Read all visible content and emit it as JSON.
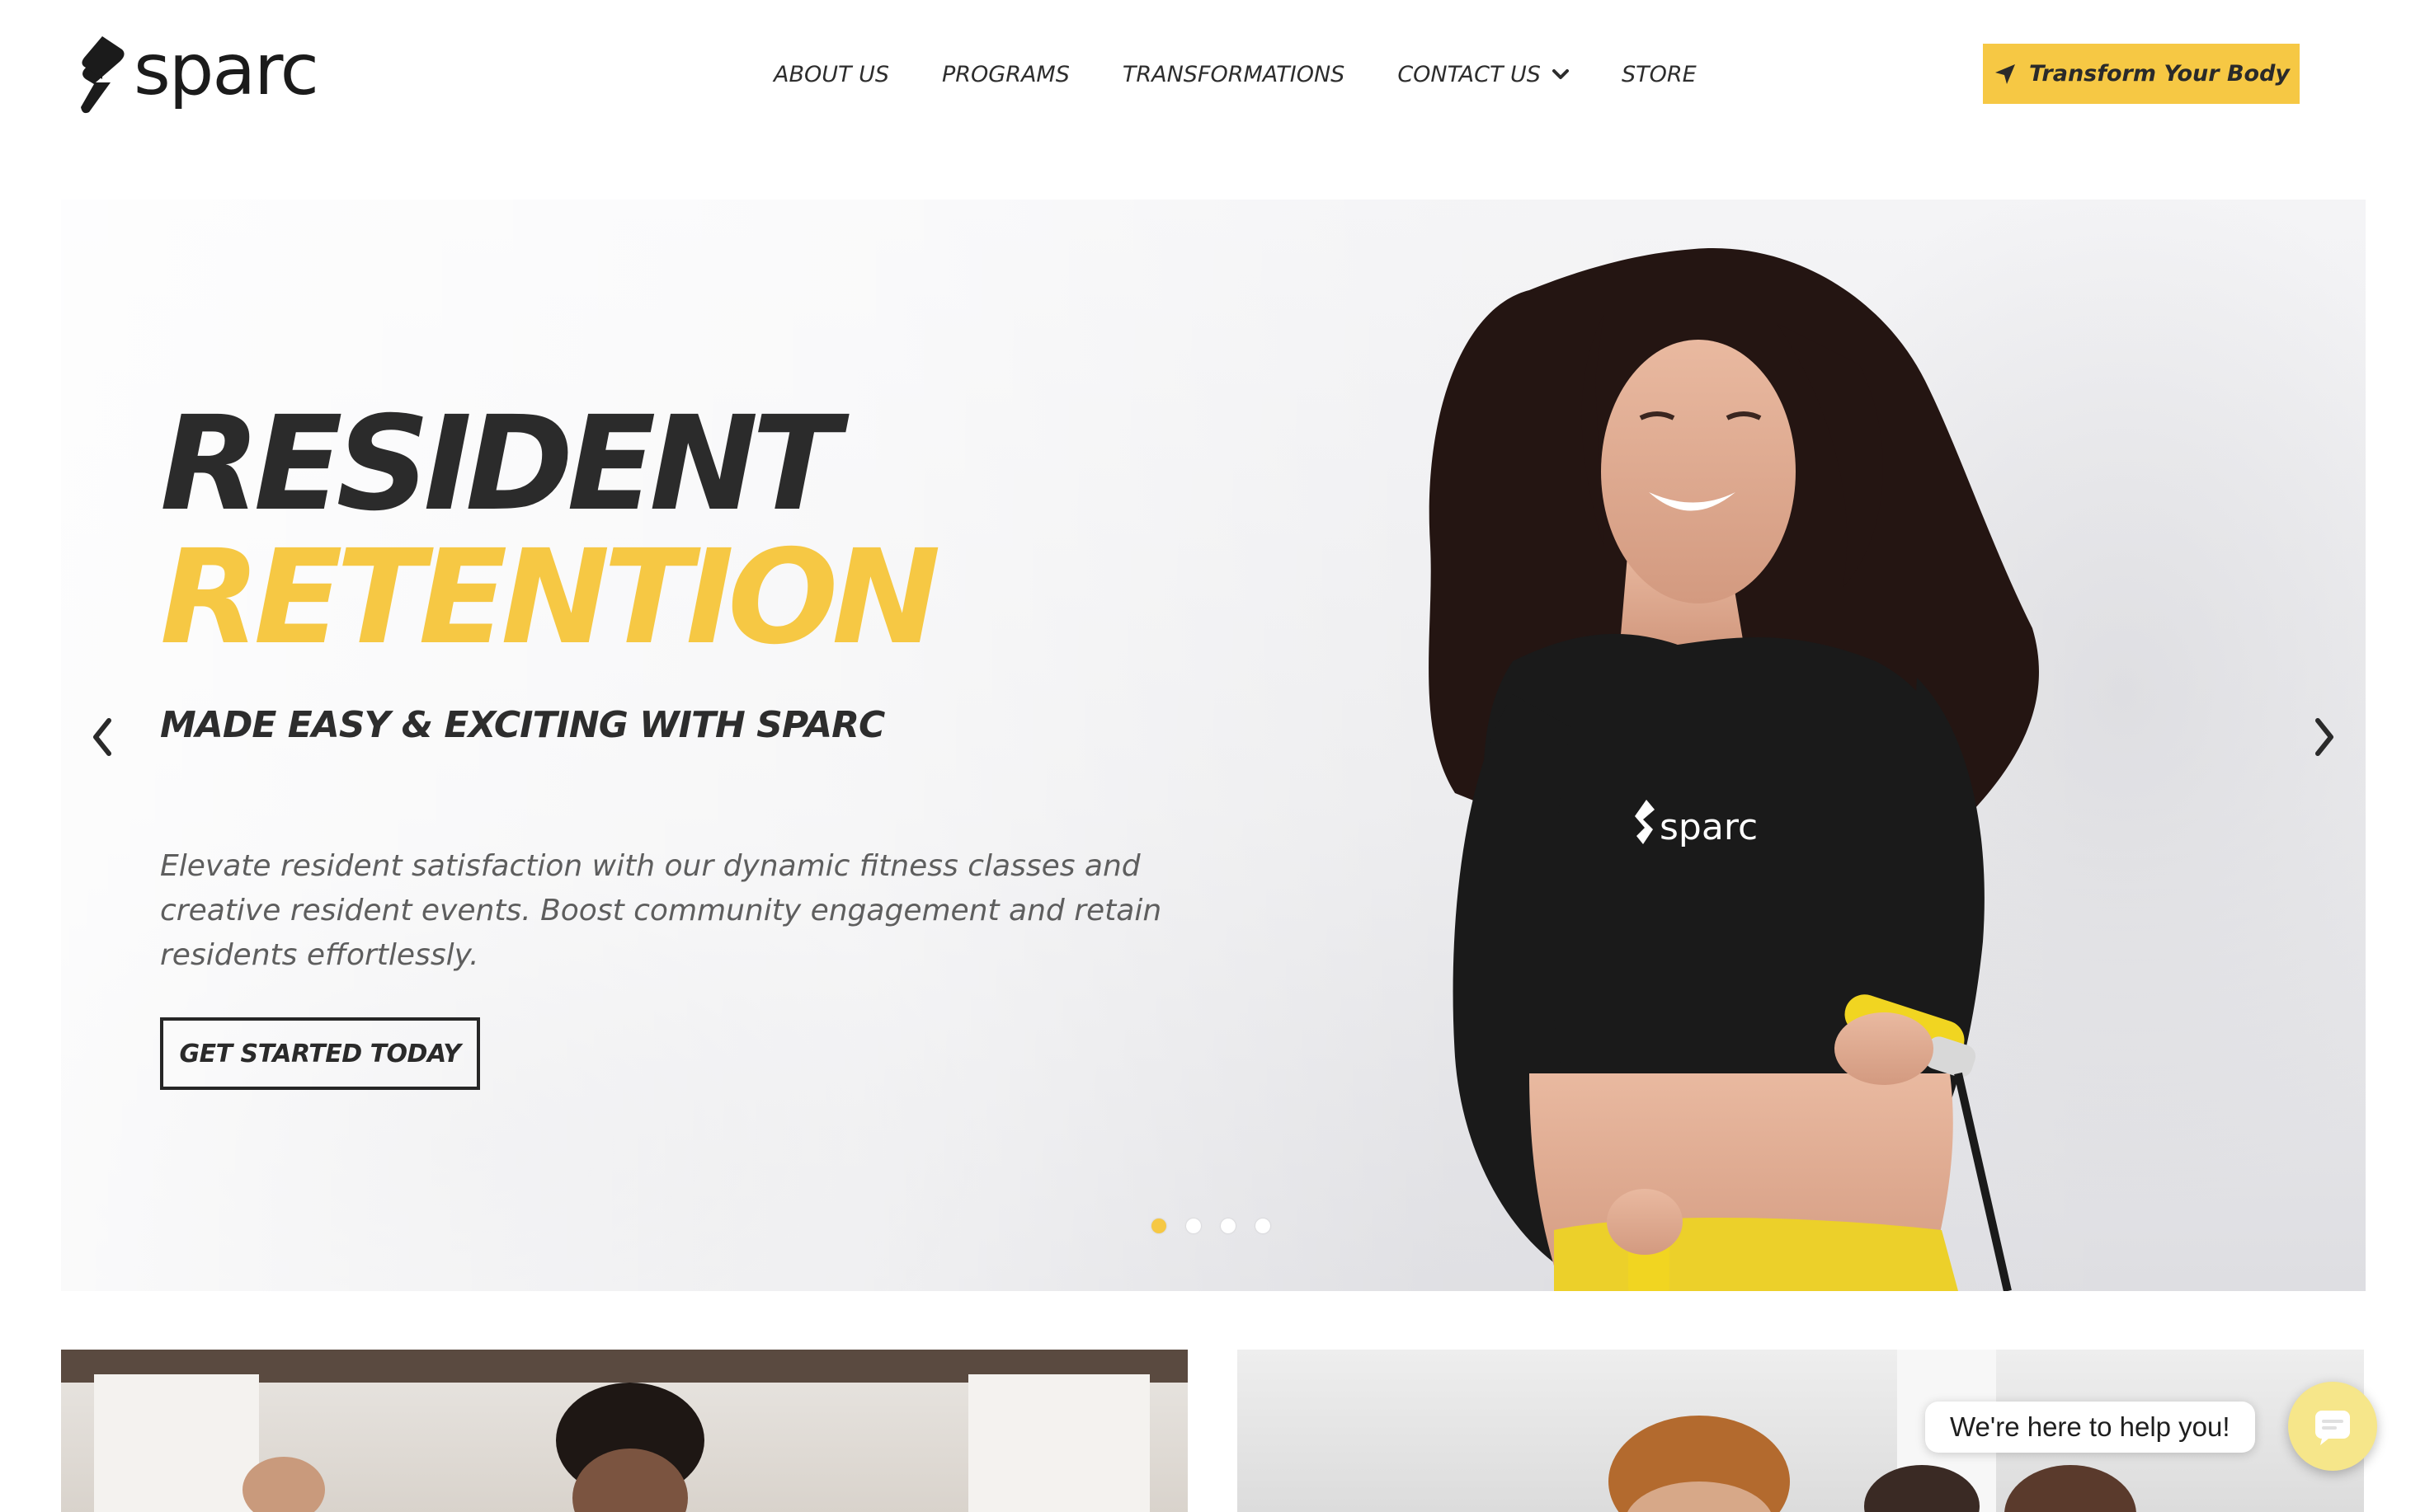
{
  "brand": {
    "name": "sparc",
    "accent_color": "#f6c844",
    "text_color": "#2b2b2b"
  },
  "nav": {
    "items": [
      {
        "label": "ABOUT US"
      },
      {
        "label": "PROGRAMS"
      },
      {
        "label": "TRANSFORMATIONS"
      },
      {
        "label": "CONTACT US",
        "has_dropdown": true
      },
      {
        "label": "STORE"
      }
    ],
    "cta_label": "Transform Your Body",
    "cta_icon": "location-arrow-icon"
  },
  "hero": {
    "title_line1": "RESIDENT",
    "title_line2": "RETENTION",
    "subtitle": "MADE EASY & EXCITING WITH SPARC",
    "description": "Elevate resident satisfaction with our dynamic fitness classes and creative resident events. Boost community engagement and retain residents effortlessly.",
    "button_label": "GET STARTED TODAY",
    "shirt_logo_text": "sparc",
    "slides_total": 4,
    "active_slide": 1
  },
  "chat": {
    "bubble_text": "We're here to help you!",
    "icon": "chat-icon"
  }
}
